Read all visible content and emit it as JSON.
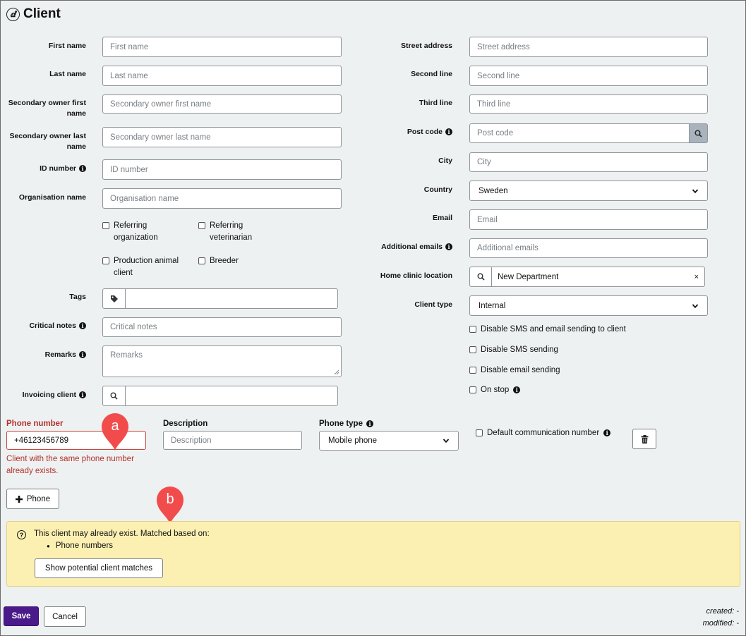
{
  "page": {
    "title": "Client",
    "title_icon": "bug-circle-icon"
  },
  "left": {
    "first_name": {
      "label": "First name",
      "placeholder": "First name"
    },
    "last_name": {
      "label": "Last name",
      "placeholder": "Last name"
    },
    "sec_first": {
      "label": "Secondary owner first name",
      "placeholder": "Secondary owner first name"
    },
    "sec_last": {
      "label": "Secondary owner last name",
      "placeholder": "Secondary owner last name"
    },
    "id_number": {
      "label": "ID number",
      "placeholder": "ID number"
    },
    "org_name": {
      "label": "Organisation name",
      "placeholder": "Organisation name"
    },
    "checks": {
      "referring_org": "Referring organization",
      "referring_vet": "Referring veterinarian",
      "production": "Production animal client",
      "breeder": "Breeder"
    },
    "tags": {
      "label": "Tags",
      "value": ""
    },
    "critical_notes": {
      "label": "Critical notes",
      "placeholder": "Critical notes"
    },
    "remarks": {
      "label": "Remarks",
      "placeholder": "Remarks"
    },
    "invoicing": {
      "label": "Invoicing client",
      "value": ""
    }
  },
  "right": {
    "street": {
      "label": "Street address",
      "placeholder": "Street address"
    },
    "second": {
      "label": "Second line",
      "placeholder": "Second line"
    },
    "third": {
      "label": "Third line",
      "placeholder": "Third line"
    },
    "post_code": {
      "label": "Post code",
      "placeholder": "Post code"
    },
    "city": {
      "label": "City",
      "placeholder": "City"
    },
    "country": {
      "label": "Country",
      "value": "Sweden"
    },
    "email": {
      "label": "Email",
      "placeholder": "Email"
    },
    "additional_emails": {
      "label": "Additional emails",
      "placeholder": "Additional emails"
    },
    "home_clinic": {
      "label": "Home clinic location",
      "value": "New Department",
      "clear": "×"
    },
    "client_type": {
      "label": "Client type",
      "value": "Internal"
    },
    "checks": {
      "disable_sms_email": "Disable SMS and email sending to client",
      "disable_sms": "Disable SMS sending",
      "disable_email": "Disable email sending",
      "on_stop": "On stop"
    }
  },
  "phone": {
    "number_label": "Phone number",
    "number_value": "+46123456789",
    "error": "Client with the same phone number already exists.",
    "description_label": "Description",
    "description_placeholder": "Description",
    "type_label": "Phone type",
    "type_value": "Mobile phone",
    "default_label": "Default communication number",
    "add_button": "Phone"
  },
  "annotations": {
    "a": "a",
    "b": "b",
    "color": "#f24b4b"
  },
  "alert": {
    "message": "This client may already exist. Matched based on:",
    "items": [
      "Phone numbers"
    ],
    "button": "Show potential client matches"
  },
  "footer": {
    "save": "Save",
    "cancel": "Cancel",
    "created": "created: -",
    "modified": "modified: -"
  },
  "colors": {
    "primary": "#4a1a8a",
    "error": "#b5322b",
    "warning_bg": "#fbf0b2",
    "page_bg": "#eef1f2"
  }
}
